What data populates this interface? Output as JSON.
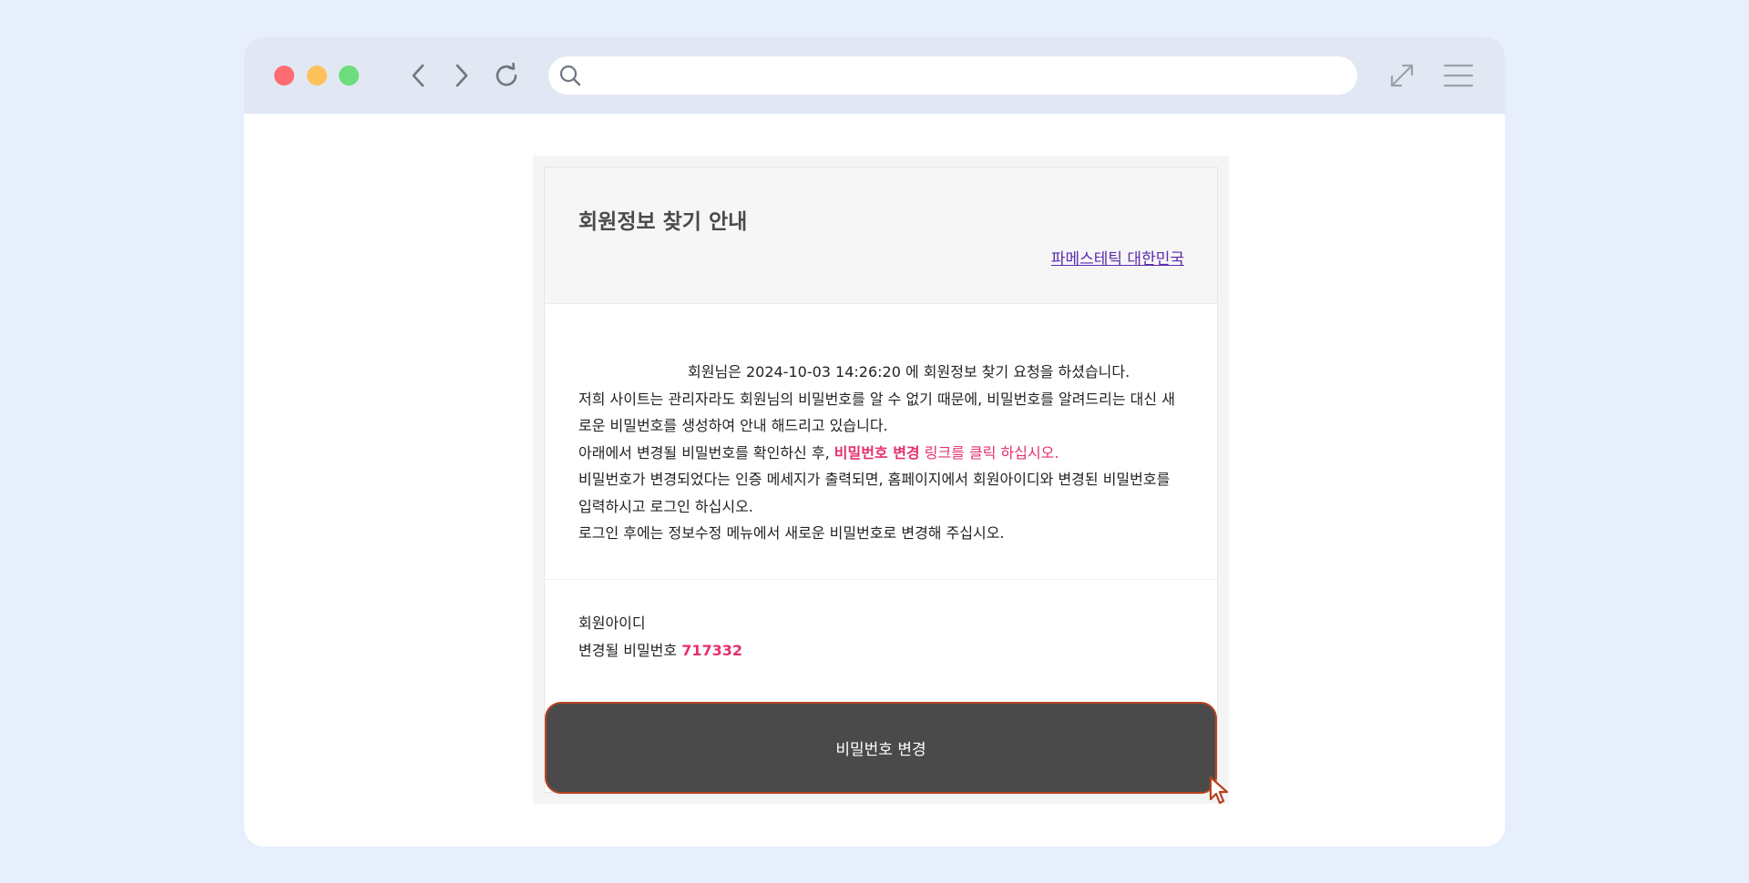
{
  "browser": {
    "address_value": ""
  },
  "email": {
    "title": "회원정보 찾기 안내",
    "brand_link": "파메스테틱 대한민국",
    "message": {
      "line1": "회원님은 2024-10-03 14:26:20 에 회원정보 찾기 요청을 하셨습니다.",
      "line2": "저희 사이트는 관리자라도 회원님의 비밀번호를 알 수 없기 때문에, 비밀번호를 알려드리는 대신 새로운 비밀번호를 생성하여 안내 해드리고 있습니다.",
      "line3_prefix": "아래에서 변경될 비밀번호를 확인하신 후, ",
      "line3_bold": "비밀번호 변경",
      "line3_suffix": " 링크를 클릭 하십시오.",
      "line4": "비밀번호가 변경되었다는 인증 메세지가 출력되면, 홈페이지에서 회원아이디와 변경된 비밀번호를 입력하시고 로그인 하십시오.",
      "line5": "로그인 후에는 정보수정 메뉴에서 새로운 비밀번호로 변경해 주십시오."
    },
    "account": {
      "id_label": "회원아이디",
      "id_value": "",
      "pw_label": "변경될 비밀번호",
      "pw_value": "717332"
    },
    "button_label": "비밀번호 변경"
  },
  "colors": {
    "highlight": "#e5306b",
    "button_bg": "#4a4a4a",
    "button_border": "#b8431f",
    "link": "#5b2ab0"
  }
}
